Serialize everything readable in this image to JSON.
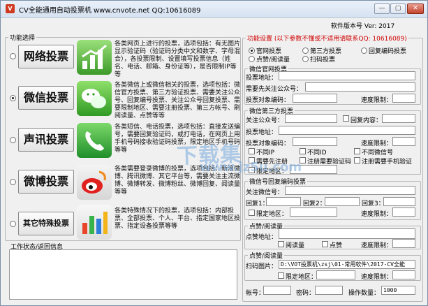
{
  "title_bar": {
    "title": "CV全能通用自动投票机   www.cnvote.net   QQ:10616089",
    "controls": [
      "—",
      "▢",
      "✕"
    ]
  },
  "version_label": "软件版本号 Ver: 2017",
  "functions": {
    "legend": "功能选择",
    "items": [
      {
        "label": "网络投票",
        "selected": false,
        "icon": "network-icon",
        "desc": "各类网页上进行的投票，选项包括：有无图片显示验证码（验证码分类中文和数字、字母混合），各投票限制、设置填写投票信息（姓名、电话、邮箱、身份证等），是否限制IP等等"
      },
      {
        "label": "微信投票",
        "selected": true,
        "icon": "wechat-icon",
        "desc": "各类微信上或微信相关的投票，选项包括：微信官方投票、第三方验证投票、需要关注公众号、回复编号投票、关注公众号回复投票、需要限制地区、需要注册投票、第三方帐号、刷阅读量、点赞等等"
      },
      {
        "label": "声讯投票",
        "selected": false,
        "icon": "phone-icon",
        "desc": "各类短信、电话投票，选项包括：直接发送编号，需要回复验证码，或打电话，在网页上用手机号码接收验证码投票，限定地区手机号码等等"
      },
      {
        "label": "微博投票",
        "selected": false,
        "icon": "weibo-icon",
        "desc": "各类需要登录微博的投票，选项包括：新浪微博、腾讯微博、其它平台等，需要关注主流微博、微博转发、微博粉丝、微博回复、阅读量等等"
      },
      {
        "label": "其它特殊投票",
        "selected": false,
        "icon": "chart-icon",
        "desc": "各类特殊情况下的投票，选项包括：内部投票、全部投票、个人、平台、指定国家地区投票、指定设备投票等等"
      }
    ]
  },
  "status": {
    "legend": "工作状态/返回信息",
    "text": ""
  },
  "settings": {
    "legend": "功能设置 (以下参数不懂或不适用请联系QQ: 10616089)",
    "modes": [
      {
        "label": "官网投票",
        "selected": true
      },
      {
        "label": "第三方投票",
        "selected": false
      },
      {
        "label": "回复编码投票",
        "selected": false
      },
      {
        "label": "点赞/阅读量",
        "selected": false
      },
      {
        "label": "扫码投票",
        "selected": false
      }
    ],
    "official": {
      "legend": "微信官网投票",
      "addr_label": "投票地址：",
      "addr_value": "",
      "follow_label": "需要先关注公众号：",
      "follow_value": "",
      "target_label": "投票对象编码：",
      "target_value": "",
      "speed_label": "速度限制：",
      "speed_value": ""
    },
    "third": {
      "legend": "微信第三方投票",
      "follow_label": "关注公众号：",
      "follow_value": "",
      "reply_label": "回复内容：",
      "reply_value": "",
      "addr_label": "投票地址：",
      "addr_value": "",
      "target_label": "投票对象编码：",
      "target_value": "",
      "speed_label": "速度限制：",
      "speed_value": "",
      "checks": [
        {
          "label": "不同IP"
        },
        {
          "label": "不同ID"
        },
        {
          "label": "不同微信号"
        },
        {
          "label": "需要先注册"
        },
        {
          "label": "注册需要验证码"
        },
        {
          "label": "注册需要手机验证"
        },
        {
          "label": "限定地区："
        }
      ],
      "region_value": ""
    },
    "reply": {
      "legend": "微信号回复编码投票",
      "follow_label": "关注微信号：",
      "follow_value": "",
      "r1_label": "回复1：",
      "r1_value": "",
      "r2_label": "回复2：",
      "r2_value": "",
      "r3_label": "回复3：",
      "r3_value": "",
      "region_label": "限定地区：",
      "region_value": "",
      "speed_label": "速度限制：",
      "speed_value": ""
    },
    "like": {
      "legend": "点赞/阅读量",
      "addr_label": "点赞地址：",
      "addr_value": "",
      "read_label": "阅读量",
      "like_label": "点赞",
      "speed_label": "速度限制：",
      "speed_value": ""
    },
    "scan": {
      "legend": "点赞/阅读量",
      "img_label": "扫码图片：",
      "img_value": "D:\\VOT投票机\\zsj\\01-常用软件\\2017-CV全能",
      "region_label": "限定地区：",
      "region_value": "",
      "speed_label": "速度限制：",
      "speed_value": ""
    },
    "account": {
      "acct_label": "帐号：",
      "acct_value": "",
      "pwd_label": "密码：",
      "pwd_value": "",
      "count_label": "操作数量：",
      "count_value": "1000"
    }
  },
  "watermark": {
    "line1": "下载集",
    "line2": "www.jz5u.com"
  }
}
